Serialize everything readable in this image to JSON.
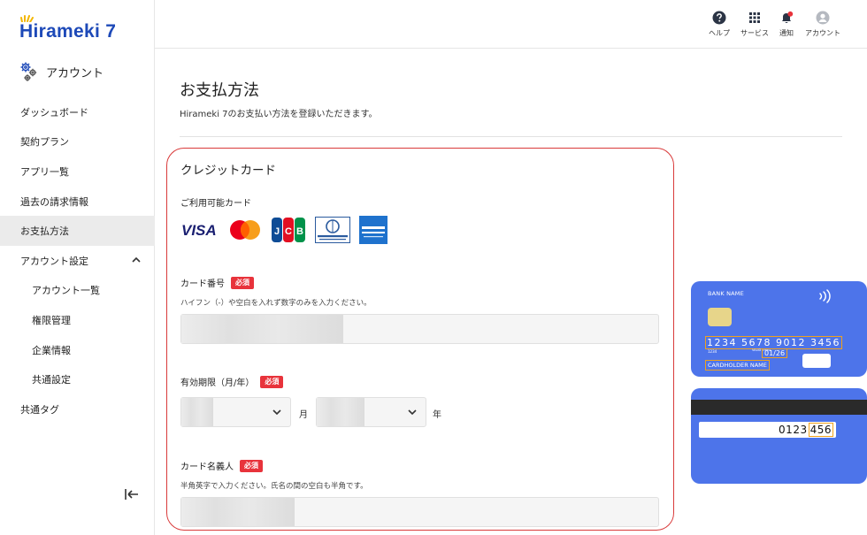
{
  "sidebar": {
    "logo": "Hirameki 7",
    "account_heading": "アカウント",
    "items": [
      {
        "label": "ダッシュボード"
      },
      {
        "label": "契約プラン"
      },
      {
        "label": "アプリ一覧"
      },
      {
        "label": "過去の請求情報"
      },
      {
        "label": "お支払方法",
        "active": true
      },
      {
        "label": "アカウント設定",
        "expanded": true
      },
      {
        "label": "アカウント一覧",
        "sub": true
      },
      {
        "label": "権限管理",
        "sub": true
      },
      {
        "label": "企業情報",
        "sub": true
      },
      {
        "label": "共通設定",
        "sub": true
      },
      {
        "label": "共通タグ"
      }
    ]
  },
  "header": {
    "help": "ヘルプ",
    "services": "サービス",
    "notifications": "通知",
    "account": "アカウント"
  },
  "main": {
    "title": "お支払方法",
    "subtitle": "Hirameki 7のお支払い方法を登録いただきます。",
    "credit_card": {
      "heading": "クレジットカード",
      "available_label": "ご利用可能カード",
      "brands": [
        "visa",
        "mastercard",
        "jcb",
        "diners-club",
        "american-express"
      ],
      "required_badge": "必須",
      "card_number": {
        "label": "カード番号",
        "hint": "ハイフン（-）や空白を入れず数字のみを入力ください。"
      },
      "expiry": {
        "label": "有効期限（月/年）",
        "month_unit": "月",
        "year_unit": "年"
      },
      "holder": {
        "label": "カード名義人",
        "hint": "半角英字で入力ください。氏名の間の空白も半角です。"
      }
    }
  },
  "card_illustration": {
    "bank_name": "BANK NAME",
    "number": "1234  5678  9012  3456",
    "number_small": "1234",
    "valid_label": "VALID THRU",
    "expiry": "01/26",
    "holder": "CARDHOLDER NAME",
    "back_digits": "0123",
    "cvv": "456"
  },
  "colors": {
    "brand_blue": "#1d49b8",
    "required_red": "#e8333b",
    "card_blue": "#4d74ea",
    "highlight_orange": "#f0a21d",
    "notification_dot": "#e8333b"
  }
}
